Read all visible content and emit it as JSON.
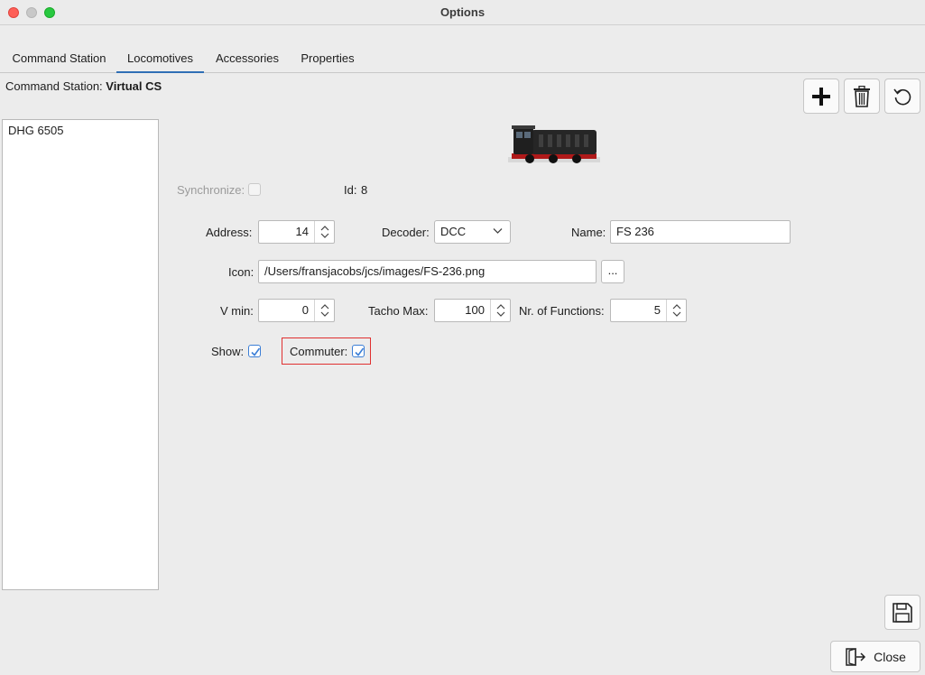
{
  "window": {
    "title": "Options"
  },
  "tabs": [
    {
      "label": "Command Station",
      "active": false
    },
    {
      "label": "Locomotives",
      "active": true
    },
    {
      "label": "Accessories",
      "active": false
    },
    {
      "label": "Properties",
      "active": false
    }
  ],
  "command_station": {
    "label": "Command Station:",
    "value": "Virtual CS"
  },
  "toolbar": {
    "add_icon": "plus-icon",
    "delete_icon": "trash-icon",
    "refresh_icon": "refresh-icon"
  },
  "locomotive_list": {
    "items": [
      "DHG 6505"
    ]
  },
  "form": {
    "synchronize_label": "Synchronize:",
    "synchronize_checked": false,
    "id_label": "Id:",
    "id_value": "8",
    "address_label": "Address:",
    "address_value": "14",
    "decoder_label": "Decoder:",
    "decoder_value": "DCC",
    "name_label": "Name:",
    "name_value": "FS 236",
    "icon_label": "Icon:",
    "icon_value": "/Users/fransjacobs/jcs/images/FS-236.png",
    "browse_label": "...",
    "vmin_label": "V min:",
    "vmin_value": "0",
    "tacho_label": "Tacho Max:",
    "tacho_value": "100",
    "functions_label": "Nr. of Functions:",
    "functions_value": "5",
    "show_label": "Show:",
    "show_checked": true,
    "commuter_label": "Commuter:",
    "commuter_checked": true
  },
  "footer": {
    "save_icon": "save-icon",
    "close_label": "Close",
    "close_icon": "exit-door-icon"
  },
  "colors": {
    "accent": "#2f6fb5",
    "highlight": "#e03030",
    "checkbox": "#3b7ed6"
  }
}
